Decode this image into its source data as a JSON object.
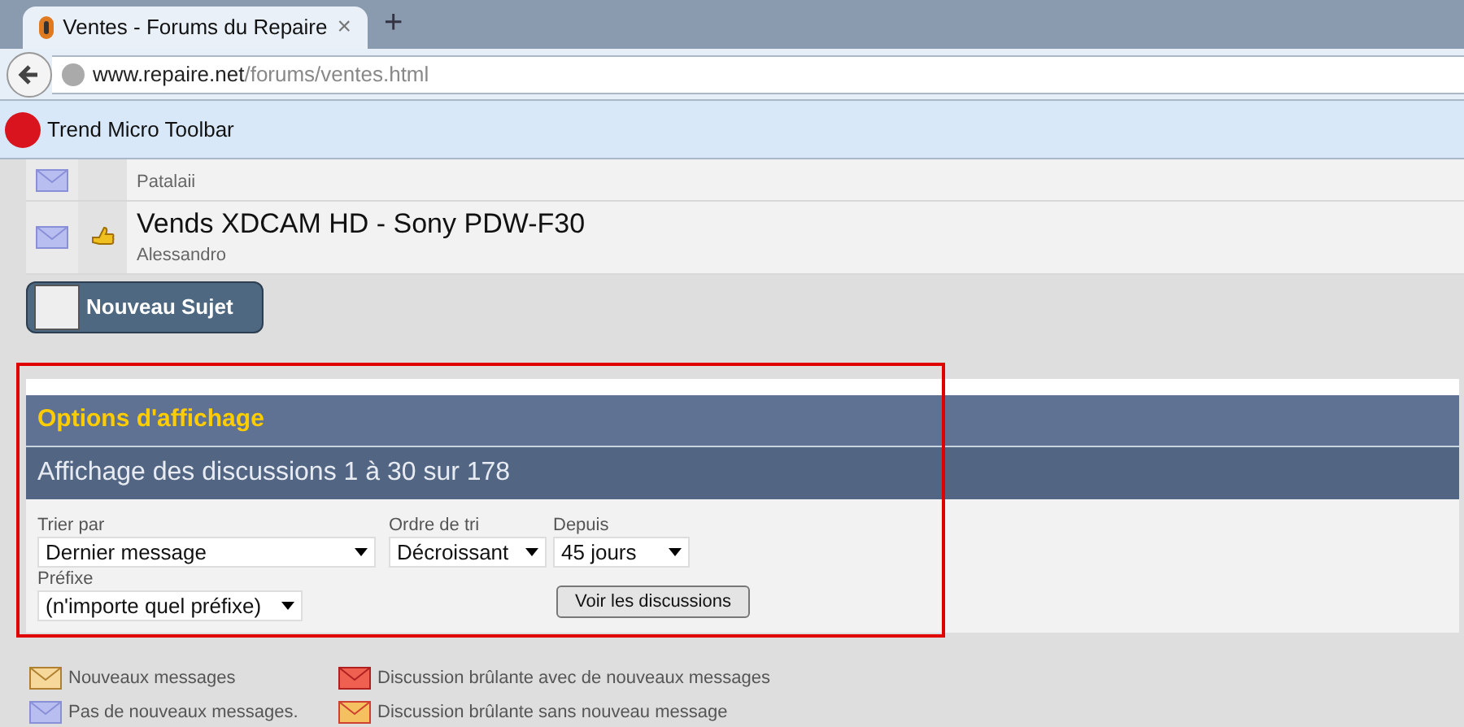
{
  "browser": {
    "tab_title": "Ventes - Forums du Repaire",
    "new_tab": "+",
    "close": "×",
    "url_host": "www.repaire.net",
    "url_path": "/forums/ventes.html",
    "toolbar_label": "Trend Micro Toolbar"
  },
  "threads": [
    {
      "author": "Patalaii",
      "thumb": false
    },
    {
      "title": "Vends XDCAM HD - Sony PDW-F30",
      "author": "Alessandro",
      "thumb": true
    }
  ],
  "new_topic_button": "Nouveau Sujet",
  "display_options": {
    "title": "Options d'affichage",
    "summary": "Affichage des discussions 1 à 30 sur 178",
    "fields": [
      {
        "label": "Trier par",
        "value": "Dernier message"
      },
      {
        "label": "Ordre de tri",
        "value": "Décroissant"
      },
      {
        "label": "Depuis",
        "value": "45 jours"
      },
      {
        "label": "Préfixe",
        "value": "(n'importe quel préfixe)"
      }
    ],
    "submit": "Voir les discussions"
  },
  "legend": [
    {
      "kind": "new",
      "text": "Nouveaux messages"
    },
    {
      "kind": "hot_new",
      "text": "Discussion brûlante avec de nouveaux messages"
    },
    {
      "kind": "old",
      "text": "Pas de nouveaux messages."
    },
    {
      "kind": "hot_old",
      "text": "Discussion brûlante sans nouveau message"
    }
  ]
}
